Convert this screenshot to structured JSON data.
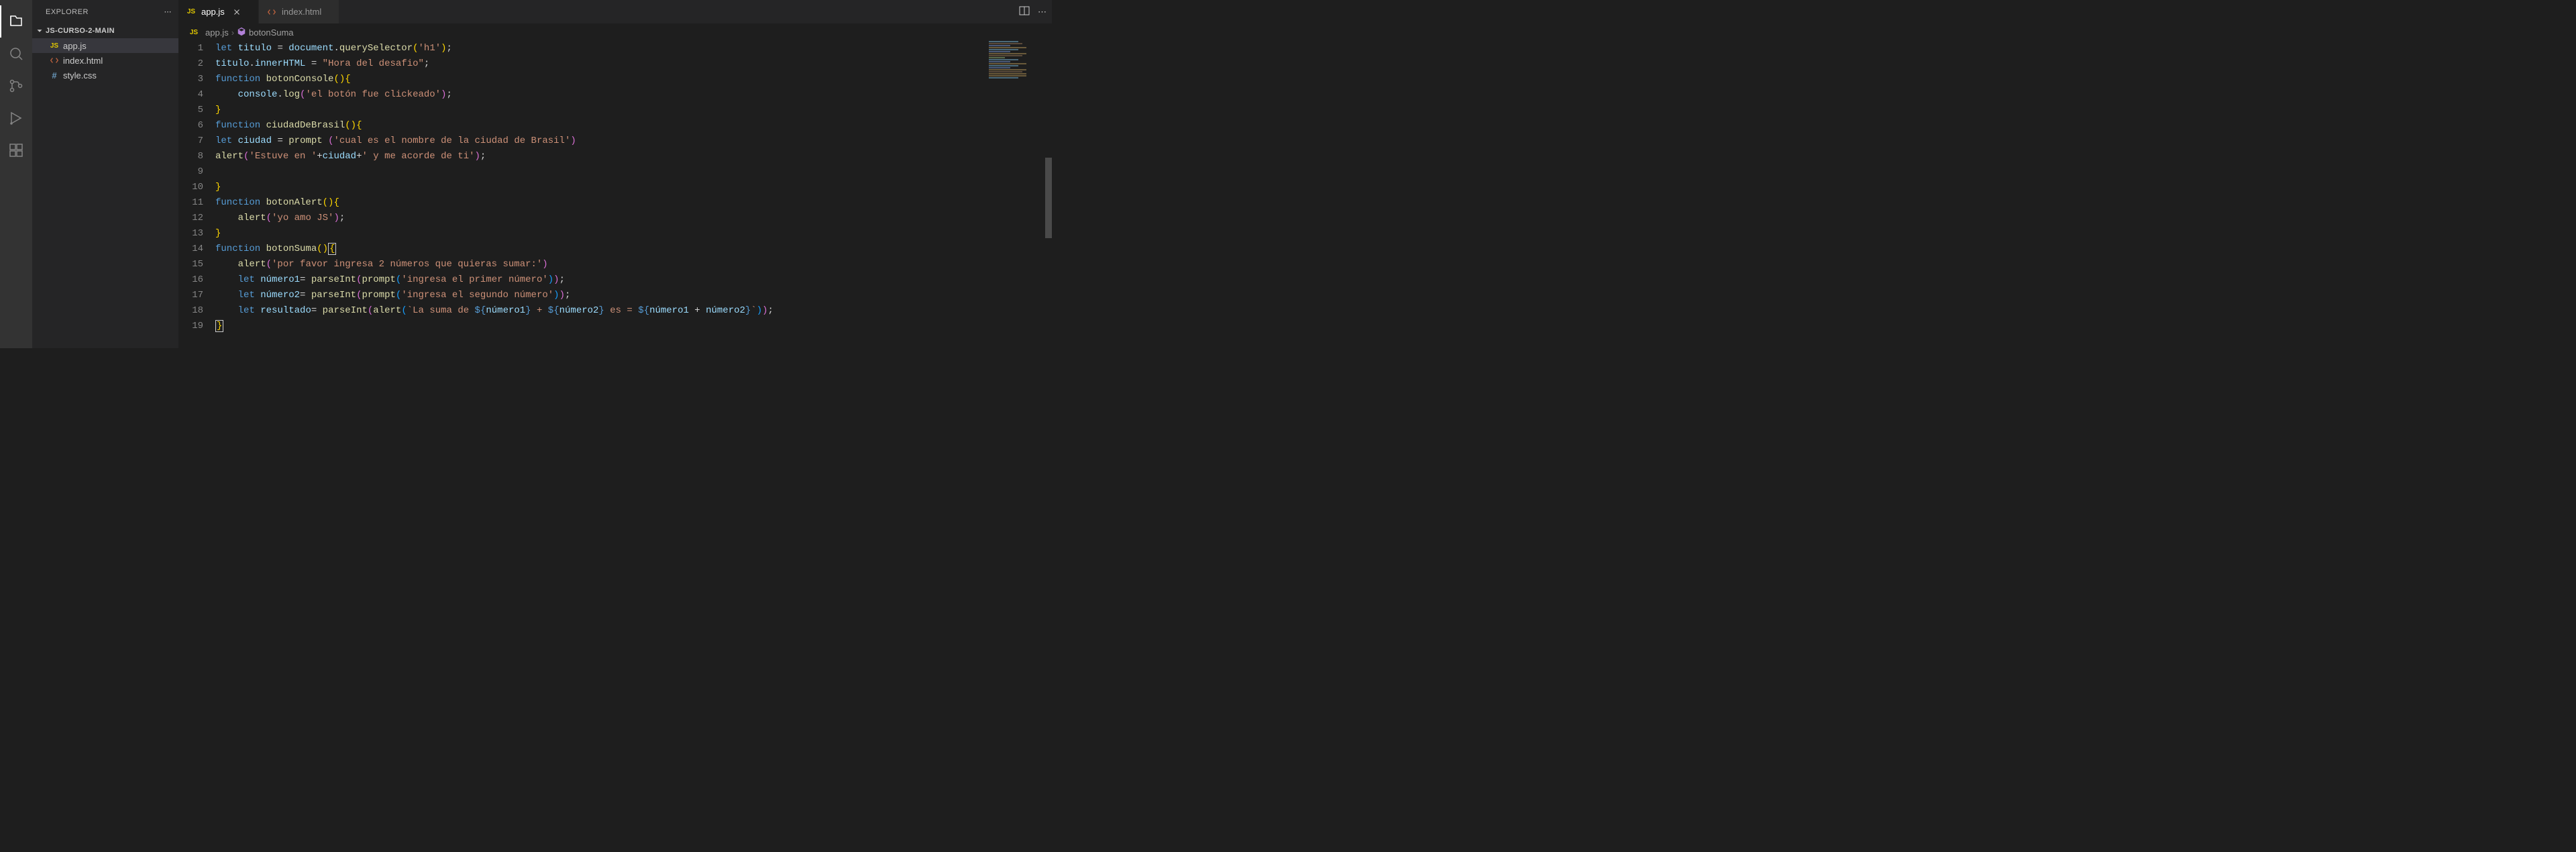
{
  "sidebar": {
    "title": "EXPLORER",
    "project": "JS-CURSO-2-MAIN",
    "files": [
      {
        "name": "app.js",
        "icon": "JS",
        "type": "js",
        "active": true
      },
      {
        "name": "index.html",
        "icon": "<>",
        "type": "html",
        "active": false
      },
      {
        "name": "style.css",
        "icon": "#",
        "type": "css",
        "active": false
      }
    ]
  },
  "tabs": [
    {
      "name": "app.js",
      "icon": "JS",
      "type": "js",
      "active": true
    },
    {
      "name": "index.html",
      "icon": "<>",
      "type": "html",
      "active": false
    }
  ],
  "breadcrumb": {
    "file_icon": "JS",
    "file": "app.js",
    "symbol": "botonSuma"
  },
  "code": {
    "lines": [
      {
        "n": 1,
        "tokens": [
          [
            "kw",
            "let"
          ],
          [
            "default",
            " "
          ],
          [
            "var",
            "titulo"
          ],
          [
            "default",
            " "
          ],
          [
            "punct",
            "="
          ],
          [
            "default",
            " "
          ],
          [
            "var",
            "document"
          ],
          [
            "punct",
            "."
          ],
          [
            "fn",
            "querySelector"
          ],
          [
            "brace",
            "("
          ],
          [
            "str",
            "'h1'"
          ],
          [
            "brace",
            ")"
          ],
          [
            "punct",
            ";"
          ]
        ]
      },
      {
        "n": 2,
        "tokens": [
          [
            "var",
            "titulo"
          ],
          [
            "punct",
            "."
          ],
          [
            "var",
            "innerHTML"
          ],
          [
            "default",
            " "
          ],
          [
            "punct",
            "="
          ],
          [
            "default",
            " "
          ],
          [
            "str",
            "\"Hora del desafio\""
          ],
          [
            "punct",
            ";"
          ]
        ]
      },
      {
        "n": 3,
        "tokens": [
          [
            "kw",
            "function"
          ],
          [
            "default",
            " "
          ],
          [
            "fn",
            "botonConsole"
          ],
          [
            "brace",
            "()"
          ],
          [
            "brace",
            "{"
          ]
        ]
      },
      {
        "n": 4,
        "indent": 1,
        "tokens": [
          [
            "var",
            "console"
          ],
          [
            "punct",
            "."
          ],
          [
            "fn",
            "log"
          ],
          [
            "brace2",
            "("
          ],
          [
            "str",
            "'el botón fue clickeado'"
          ],
          [
            "brace2",
            ")"
          ],
          [
            "punct",
            ";"
          ]
        ]
      },
      {
        "n": 5,
        "tokens": [
          [
            "brace",
            "}"
          ]
        ]
      },
      {
        "n": 6,
        "tokens": [
          [
            "kw",
            "function"
          ],
          [
            "default",
            " "
          ],
          [
            "fn",
            "ciudadDeBrasil"
          ],
          [
            "brace",
            "()"
          ],
          [
            "brace",
            "{"
          ]
        ]
      },
      {
        "n": 7,
        "tokens": [
          [
            "kw",
            "let"
          ],
          [
            "default",
            " "
          ],
          [
            "var",
            "ciudad"
          ],
          [
            "default",
            " "
          ],
          [
            "punct",
            "="
          ],
          [
            "default",
            " "
          ],
          [
            "fn",
            "prompt"
          ],
          [
            "default",
            " "
          ],
          [
            "brace2",
            "("
          ],
          [
            "str",
            "'cual es el nombre de la ciudad de Brasil'"
          ],
          [
            "brace2",
            ")"
          ]
        ]
      },
      {
        "n": 8,
        "tokens": [
          [
            "fn",
            "alert"
          ],
          [
            "brace2",
            "("
          ],
          [
            "str",
            "'Estuve en '"
          ],
          [
            "punct",
            "+"
          ],
          [
            "var",
            "ciudad"
          ],
          [
            "punct",
            "+"
          ],
          [
            "str",
            "' y me acorde de ti'"
          ],
          [
            "brace2",
            ")"
          ],
          [
            "punct",
            ";"
          ]
        ]
      },
      {
        "n": 9,
        "tokens": []
      },
      {
        "n": 10,
        "tokens": [
          [
            "brace",
            "}"
          ]
        ]
      },
      {
        "n": 11,
        "tokens": [
          [
            "kw",
            "function"
          ],
          [
            "default",
            " "
          ],
          [
            "fn",
            "botonAlert"
          ],
          [
            "brace",
            "()"
          ],
          [
            "brace",
            "{"
          ]
        ]
      },
      {
        "n": 12,
        "indent": 1,
        "tokens": [
          [
            "fn",
            "alert"
          ],
          [
            "brace2",
            "("
          ],
          [
            "str",
            "'yo amo JS'"
          ],
          [
            "brace2",
            ")"
          ],
          [
            "punct",
            ";"
          ]
        ]
      },
      {
        "n": 13,
        "tokens": [
          [
            "brace",
            "}"
          ]
        ]
      },
      {
        "n": 14,
        "tokens": [
          [
            "kw",
            "function"
          ],
          [
            "default",
            " "
          ],
          [
            "fn",
            "botonSuma"
          ],
          [
            "brace",
            "()"
          ],
          [
            "brace",
            "{",
            "cursor"
          ]
        ]
      },
      {
        "n": 15,
        "indent": 1,
        "tokens": [
          [
            "fn",
            "alert"
          ],
          [
            "brace2",
            "("
          ],
          [
            "str",
            "'por favor ingresa 2 números que quieras sumar:'"
          ],
          [
            "brace2",
            ")"
          ]
        ]
      },
      {
        "n": 16,
        "indent": 1,
        "tokens": [
          [
            "kw",
            "let"
          ],
          [
            "default",
            " "
          ],
          [
            "var",
            "número1"
          ],
          [
            "punct",
            "="
          ],
          [
            "default",
            " "
          ],
          [
            "fn",
            "parseInt"
          ],
          [
            "brace2",
            "("
          ],
          [
            "fn",
            "prompt"
          ],
          [
            "brace3",
            "("
          ],
          [
            "str",
            "'ingresa el primer número'"
          ],
          [
            "brace3",
            ")"
          ],
          [
            "brace2",
            ")"
          ],
          [
            "punct",
            ";"
          ]
        ]
      },
      {
        "n": 17,
        "indent": 1,
        "tokens": [
          [
            "kw",
            "let"
          ],
          [
            "default",
            " "
          ],
          [
            "var",
            "número2"
          ],
          [
            "punct",
            "="
          ],
          [
            "default",
            " "
          ],
          [
            "fn",
            "parseInt"
          ],
          [
            "brace2",
            "("
          ],
          [
            "fn",
            "prompt"
          ],
          [
            "brace3",
            "("
          ],
          [
            "str",
            "'ingresa el segundo número'"
          ],
          [
            "brace3",
            ")"
          ],
          [
            "brace2",
            ")"
          ],
          [
            "punct",
            ";"
          ]
        ]
      },
      {
        "n": 18,
        "indent": 1,
        "tokens": [
          [
            "kw",
            "let"
          ],
          [
            "default",
            " "
          ],
          [
            "var",
            "resultado"
          ],
          [
            "punct",
            "="
          ],
          [
            "default",
            " "
          ],
          [
            "fn",
            "parseInt"
          ],
          [
            "brace2",
            "("
          ],
          [
            "fn",
            "alert"
          ],
          [
            "brace3",
            "("
          ],
          [
            "str",
            "`La suma de "
          ],
          [
            "tmpl",
            "${"
          ],
          [
            "var",
            "número1"
          ],
          [
            "tmpl",
            "}"
          ],
          [
            "str",
            " + "
          ],
          [
            "tmpl",
            "${"
          ],
          [
            "var",
            "número2"
          ],
          [
            "tmpl",
            "}"
          ],
          [
            "str",
            " es = "
          ],
          [
            "tmpl",
            "${"
          ],
          [
            "var",
            "número1"
          ],
          [
            "default",
            " "
          ],
          [
            "punct",
            "+"
          ],
          [
            "default",
            " "
          ],
          [
            "var",
            "número2"
          ],
          [
            "tmpl",
            "}"
          ],
          [
            "str",
            "`"
          ],
          [
            "brace3",
            ")"
          ],
          [
            "brace2",
            ")"
          ],
          [
            "punct",
            ";"
          ]
        ]
      },
      {
        "n": 19,
        "tokens": [
          [
            "brace",
            "}",
            "cursor"
          ]
        ]
      }
    ]
  }
}
